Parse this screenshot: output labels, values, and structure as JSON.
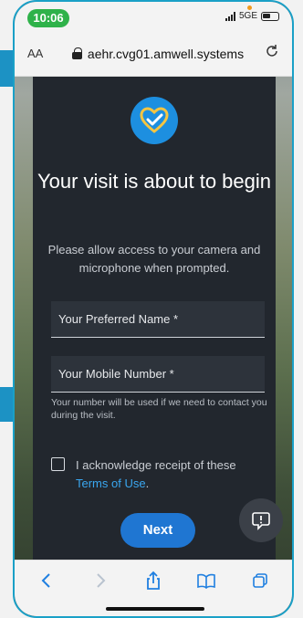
{
  "status_bar": {
    "time": "10:06",
    "network": "5G",
    "network_suffix": "E"
  },
  "browser": {
    "text_size_label": "AA",
    "url": "aehr.cvg01.amwell.systems"
  },
  "page": {
    "title": "Your visit is about to begin",
    "subtitle": "Please allow access to your camera and microphone when prompted.",
    "name_field": {
      "placeholder": "Your Preferred Name *",
      "value": ""
    },
    "mobile_field": {
      "placeholder": "Your Mobile Number *",
      "value": ""
    },
    "mobile_hint": "Your number will be used if we need to contact you during the visit.",
    "acknowledge_text": "I acknowledge receipt of these",
    "terms_link": "Terms of Use",
    "terms_suffix": ".",
    "next_button": "Next"
  },
  "colors": {
    "accent": "#1f76d2",
    "link": "#3aa7f0",
    "card": "#22272e",
    "status_pill": "#2fb24a"
  },
  "icons": [
    "lock-icon",
    "reload-icon",
    "heart-check-logo-icon",
    "chat-icon",
    "back-icon",
    "forward-icon",
    "share-icon",
    "bookmarks-icon",
    "tabs-icon"
  ]
}
